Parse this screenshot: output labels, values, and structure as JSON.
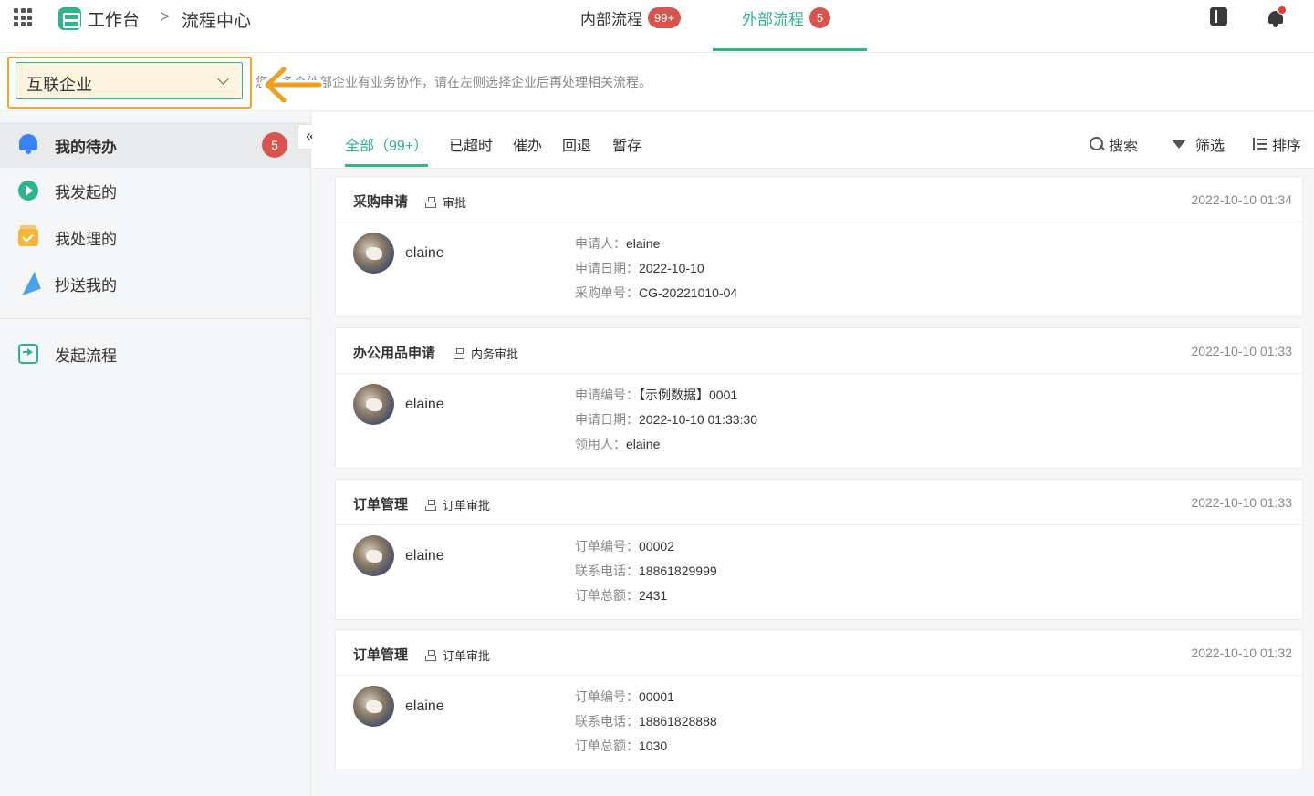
{
  "header": {
    "brand": "工作台",
    "breadcrumb_sep": ">",
    "breadcrumb_current": "流程中心",
    "tabs": [
      {
        "label": "内部流程",
        "badge": "99+"
      },
      {
        "label": "外部流程",
        "badge": "5"
      }
    ],
    "active_tab": 1,
    "accent_color": "#2fb58c"
  },
  "enterprise": {
    "selected": "互联企业",
    "hint": "您与多个外部企业有业务协作，请在左侧选择企业后再处理相关流程。"
  },
  "sidebar": {
    "collapse_glyph": "«",
    "items": [
      {
        "label": "我的待办",
        "icon": "bell-icon",
        "badge": "5",
        "active": true
      },
      {
        "label": "我发起的",
        "icon": "play-icon"
      },
      {
        "label": "我处理的",
        "icon": "check-box-icon"
      },
      {
        "label": "抄送我的",
        "icon": "paper-plane-icon"
      },
      {
        "label": "发起流程",
        "icon": "start-flow-icon"
      }
    ]
  },
  "filters": {
    "tabs": [
      "全部（99+）",
      "已超时",
      "催办",
      "回退",
      "暂存"
    ],
    "active": 0,
    "tools": {
      "search": "搜索",
      "filter": "筛选",
      "sort": "排序"
    }
  },
  "cards": [
    {
      "title": "采购申请",
      "type": "审批",
      "time": "2022-10-10 01:34",
      "user": "elaine",
      "fields": [
        {
          "k": "申请人：",
          "v": "elaine"
        },
        {
          "k": "申请日期：",
          "v": "2022-10-10"
        },
        {
          "k": "采购单号：",
          "v": "CG-20221010-04"
        }
      ]
    },
    {
      "title": "办公用品申请",
      "type": "内务审批",
      "time": "2022-10-10 01:33",
      "user": "elaine",
      "fields": [
        {
          "k": "申请编号：",
          "v": "【示例数据】0001"
        },
        {
          "k": "申请日期：",
          "v": "2022-10-10 01:33:30"
        },
        {
          "k": "领用人：",
          "v": "elaine"
        }
      ]
    },
    {
      "title": "订单管理",
      "type": "订单审批",
      "time": "2022-10-10 01:33",
      "user": "elaine",
      "fields": [
        {
          "k": "订单编号：",
          "v": "00002"
        },
        {
          "k": "联系电话：",
          "v": "18861829999"
        },
        {
          "k": "订单总额：",
          "v": "2431"
        }
      ]
    },
    {
      "title": "订单管理",
      "type": "订单审批",
      "time": "2022-10-10 01:32",
      "user": "elaine",
      "fields": [
        {
          "k": "订单编号：",
          "v": "00001"
        },
        {
          "k": "联系电话：",
          "v": "18861828888"
        },
        {
          "k": "订单总额：",
          "v": "1030"
        }
      ]
    }
  ]
}
